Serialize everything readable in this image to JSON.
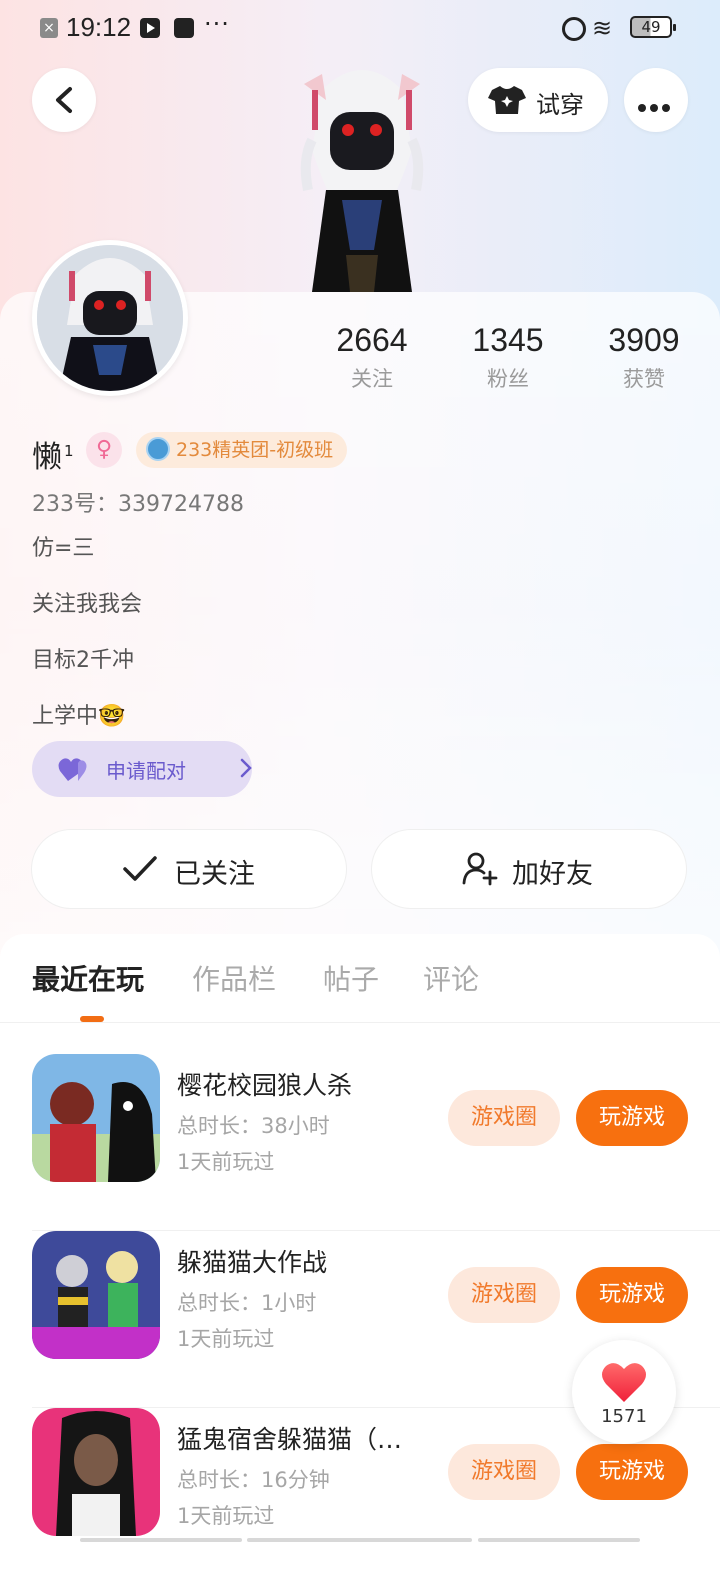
{
  "status_bar": {
    "time": "19:12",
    "x_label": "×",
    "dots": "···",
    "wifi": "≋",
    "battery": "49",
    "icons": [
      "close-notification-icon",
      "media-app-icon",
      "message-app-icon",
      "alarm-icon",
      "wifi-icon",
      "battery-icon"
    ]
  },
  "header": {
    "back_icon": "back-chevron-icon",
    "try_on_label": "试穿",
    "try_on_icon": "tshirt-icon",
    "more_icon": "more-dots-icon"
  },
  "profile": {
    "stats": [
      {
        "value": "2664",
        "label": "关注"
      },
      {
        "value": "1345",
        "label": "粉丝"
      },
      {
        "value": "3909",
        "label": "获赞"
      }
    ],
    "name": "懒",
    "name_sup": "1",
    "gender_symbol": "♀",
    "badge_text": "233精英团-初级班",
    "id_line": "233号：339724788",
    "bio": [
      "仿=三",
      "关注我我会",
      "目标2千冲",
      "上学中🤓"
    ],
    "pair_label": "申请配对",
    "followed_label": "已关注",
    "add_friend_label": "加好友"
  },
  "tabs": [
    "最近在玩",
    "作品栏",
    "帖子",
    "评论"
  ],
  "games": [
    {
      "title": "樱花校园狼人杀",
      "duration": "总时长：38小时",
      "last_played": "1天前玩过",
      "circle_label": "游戏圈",
      "play_label": "玩游戏"
    },
    {
      "title": "躲猫猫大作战",
      "duration": "总时长：1小时",
      "last_played": "1天前玩过",
      "circle_label": "游戏圈",
      "play_label": "玩游戏"
    },
    {
      "title": "猛鬼宿舍躲猫猫（…",
      "duration": "总时长：16分钟",
      "last_played": "1天前玩过",
      "circle_label": "游戏圈",
      "play_label": "玩游戏"
    }
  ],
  "like_float": {
    "count": "1571",
    "icon": "heart-icon"
  },
  "colors": {
    "accent": "#f7700f",
    "accent_soft": "#fde8dc",
    "pair_bg": "#e3dcf4",
    "pair_text": "#6a5acd"
  }
}
